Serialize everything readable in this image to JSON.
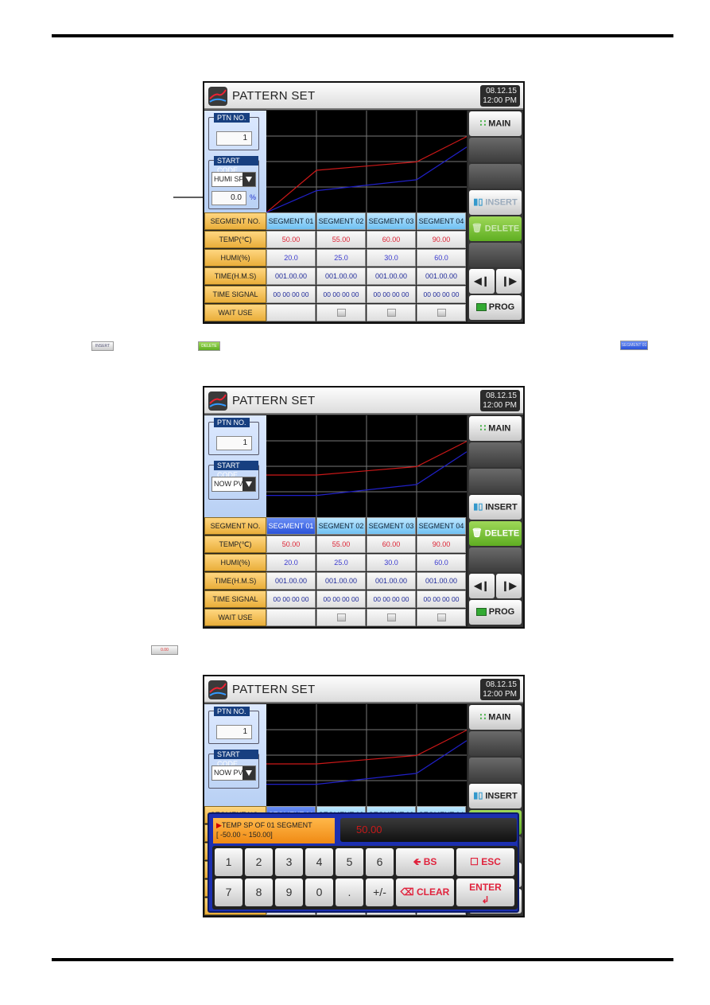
{
  "screens": [
    {
      "id": "screen1",
      "header": {
        "title": "PATTERN SET",
        "date": "08.12.15",
        "time": "12:00 PM"
      },
      "left": {
        "ptn_legend": "PTN NO.",
        "ptn_value": "1",
        "start_legend": "START CODE",
        "start_code": "HUMI SP",
        "start_value": "0.0",
        "start_unit": "%"
      },
      "buttons": {
        "main": "MAIN",
        "insert": "INSERT",
        "delete": "DELETE",
        "prog": "PROG",
        "insert_enabled": false,
        "delete_enabled": false
      },
      "active_segment": -1
    },
    {
      "id": "screen2",
      "header": {
        "title": "PATTERN SET",
        "date": "08.12.15",
        "time": "12:00 PM"
      },
      "left": {
        "ptn_legend": "PTN NO.",
        "ptn_value": "1",
        "start_legend": "START CODE",
        "start_code": "NOW PV"
      },
      "buttons": {
        "main": "MAIN",
        "insert": "INSERT",
        "delete": "DELETE",
        "prog": "PROG",
        "insert_enabled": true,
        "delete_enabled": true
      },
      "active_segment": 0
    },
    {
      "id": "screen3",
      "header": {
        "title": "PATTERN SET",
        "date": "08.12.15",
        "time": "12:00 PM"
      },
      "left": {
        "ptn_legend": "PTN NO.",
        "ptn_value": "1",
        "start_legend": "START CODE",
        "start_code": "NOW PV"
      },
      "buttons": {
        "main": "MAIN",
        "insert": "INSERT",
        "insert_enabled": true
      },
      "keypad": {
        "label_line1": "TEMP SP OF 01 SEGMENT",
        "label_line2": "[ -50.00 ~ 150.00]",
        "display": "50.00",
        "keys_row1": [
          "1",
          "2",
          "3",
          "4",
          "5",
          "6"
        ],
        "keys_row2": [
          "7",
          "8",
          "9",
          "0",
          ".",
          "+/-"
        ],
        "bs": "BS",
        "esc": "ESC",
        "clear": "CLEAR",
        "enter": "ENTER"
      }
    }
  ],
  "table": {
    "row_headers": [
      "SEGMENT NO.",
      "TEMP(℃)",
      "HUMI(%)",
      "TIME(H.M.S)",
      "TIME SIGNAL",
      "WAIT USE"
    ],
    "segments": [
      "SEGMENT 01",
      "SEGMENT 02",
      "SEGMENT 03",
      "SEGMENT 04"
    ],
    "temp": [
      "50.00",
      "55.00",
      "60.00",
      "90.00"
    ],
    "humi": [
      "20.0",
      "25.0",
      "30.0",
      "60.0"
    ],
    "time": [
      "001.00.00",
      "001.00.00",
      "001.00.00",
      "001.00.00"
    ],
    "time_signal": [
      "00 00 00 00",
      "00 00 00 00",
      "00 00 00 00",
      "00 00 00 00"
    ],
    "wait_use": [
      false,
      true,
      true,
      true
    ]
  },
  "graph_profile": {
    "temp_points_screen1": [
      0,
      50,
      55,
      60,
      90
    ],
    "humi_points_screen1": [
      0,
      20,
      25,
      30,
      60
    ],
    "temp_points_nowpv": [
      50,
      50,
      55,
      60,
      90
    ],
    "humi_points_nowpv": [
      20,
      20,
      25,
      30,
      60
    ],
    "colors": {
      "temp": "#cc1818",
      "humi": "#2020c8",
      "grid": "#777777"
    }
  },
  "inline_thumbs": {
    "insert": "INSERT",
    "delete": "DELETE",
    "segment": "SEGMENT 01",
    "value": "0.00"
  }
}
